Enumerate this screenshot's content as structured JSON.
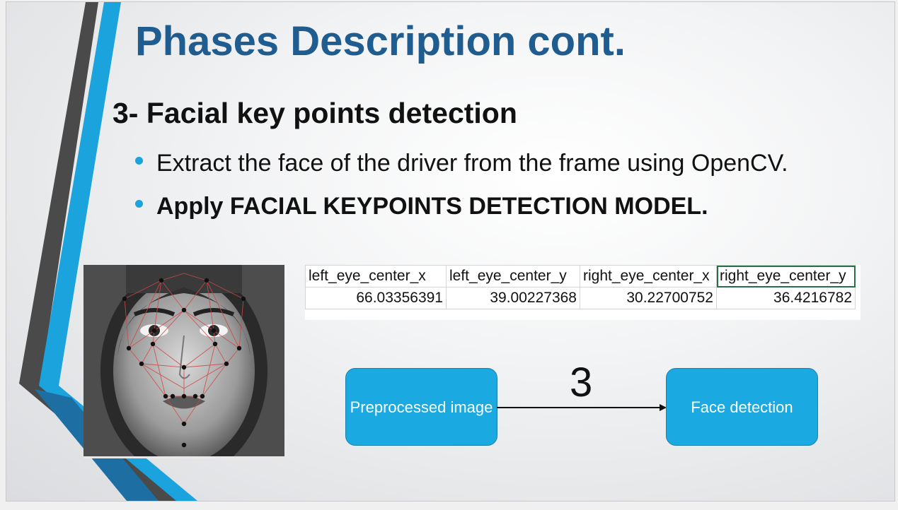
{
  "slide": {
    "title": "Phases Description cont.",
    "heading": "3- Facial key points detection",
    "bullets": [
      "Extract the face of the driver from the frame using OpenCV.",
      "Apply FACIAL KEYPOINTS DETECTION MODEL."
    ]
  },
  "keypoints_table": {
    "headers": [
      "left_eye_center_x",
      "left_eye_center_y",
      "right_eye_center_x",
      "right_eye_center_y"
    ],
    "values": [
      "66.03356391",
      "39.00227368",
      "30.22700752",
      "36.4216782"
    ]
  },
  "flow": {
    "source_label": "Preprocessed image",
    "step_number": "3",
    "target_label": "Face detection"
  },
  "colors": {
    "title": "#1f5c8f",
    "accent_blue": "#1aa3dd",
    "box_fill": "#1aa9e0",
    "dark_stripe": "#4a4a4a",
    "selection": "#217346"
  }
}
